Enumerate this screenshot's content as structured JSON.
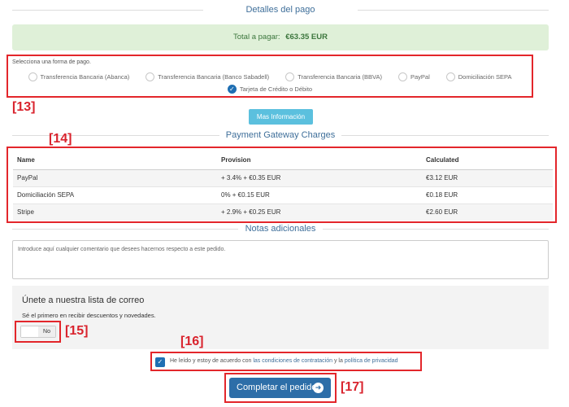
{
  "payment_details": {
    "title": "Detalles del pago",
    "total_label": "Total a pagar:",
    "total_value": "€63.35 EUR"
  },
  "payment_methods": {
    "caption": "Selecciona una forma de pago.",
    "options": [
      {
        "label": "Transferencia Bancaria (Abanca)",
        "selected": false
      },
      {
        "label": "Transferencia Bancaria (Banco Sabadell)",
        "selected": false
      },
      {
        "label": "Transferencia Bancaria (BBVA)",
        "selected": false
      },
      {
        "label": "PayPal",
        "selected": false
      },
      {
        "label": "Domiciliación SEPA",
        "selected": false
      },
      {
        "label": "Tarjeta de Crédito o Débito",
        "selected": true
      }
    ]
  },
  "more_info_label": "Mas Información",
  "gateway": {
    "title": "Payment Gateway Charges",
    "headers": [
      "Name",
      "Provision",
      "Calculated"
    ],
    "rows": [
      [
        "PayPal",
        "+ 3.4% + €0.35 EUR",
        "€3.12 EUR"
      ],
      [
        "Domiciliación SEPA",
        "0% + €0.15 EUR",
        "€0.18 EUR"
      ],
      [
        "Stripe",
        "+ 2.9% + €0.25 EUR",
        "€2.60 EUR"
      ]
    ]
  },
  "notes": {
    "title": "Notas adicionales",
    "placeholder": "Introduce aquí cualquier comentario que desees hacernos respecto a este pedido."
  },
  "mailing": {
    "heading": "Únete a nuestra lista de correo",
    "subtext": "Sé el primero en recibir descuentos y novedades.",
    "toggle_state": "No"
  },
  "terms": {
    "prefix": "He leído y estoy de acuerdo con ",
    "link_conditions": "las condiciones de contratación",
    "middle": " y la ",
    "link_privacy": "política de privacidad"
  },
  "complete_label": "Completar el pedido",
  "annotations": {
    "a13": "[13]",
    "a14": "[14]",
    "a15": "[15]",
    "a16": "[16]",
    "a17": "[17]"
  },
  "colors": {
    "annotation_red": "#e3262b",
    "primary_blue": "#2d6ea8",
    "info_cyan": "#5bc0de",
    "success_bg": "#dff0d8"
  }
}
